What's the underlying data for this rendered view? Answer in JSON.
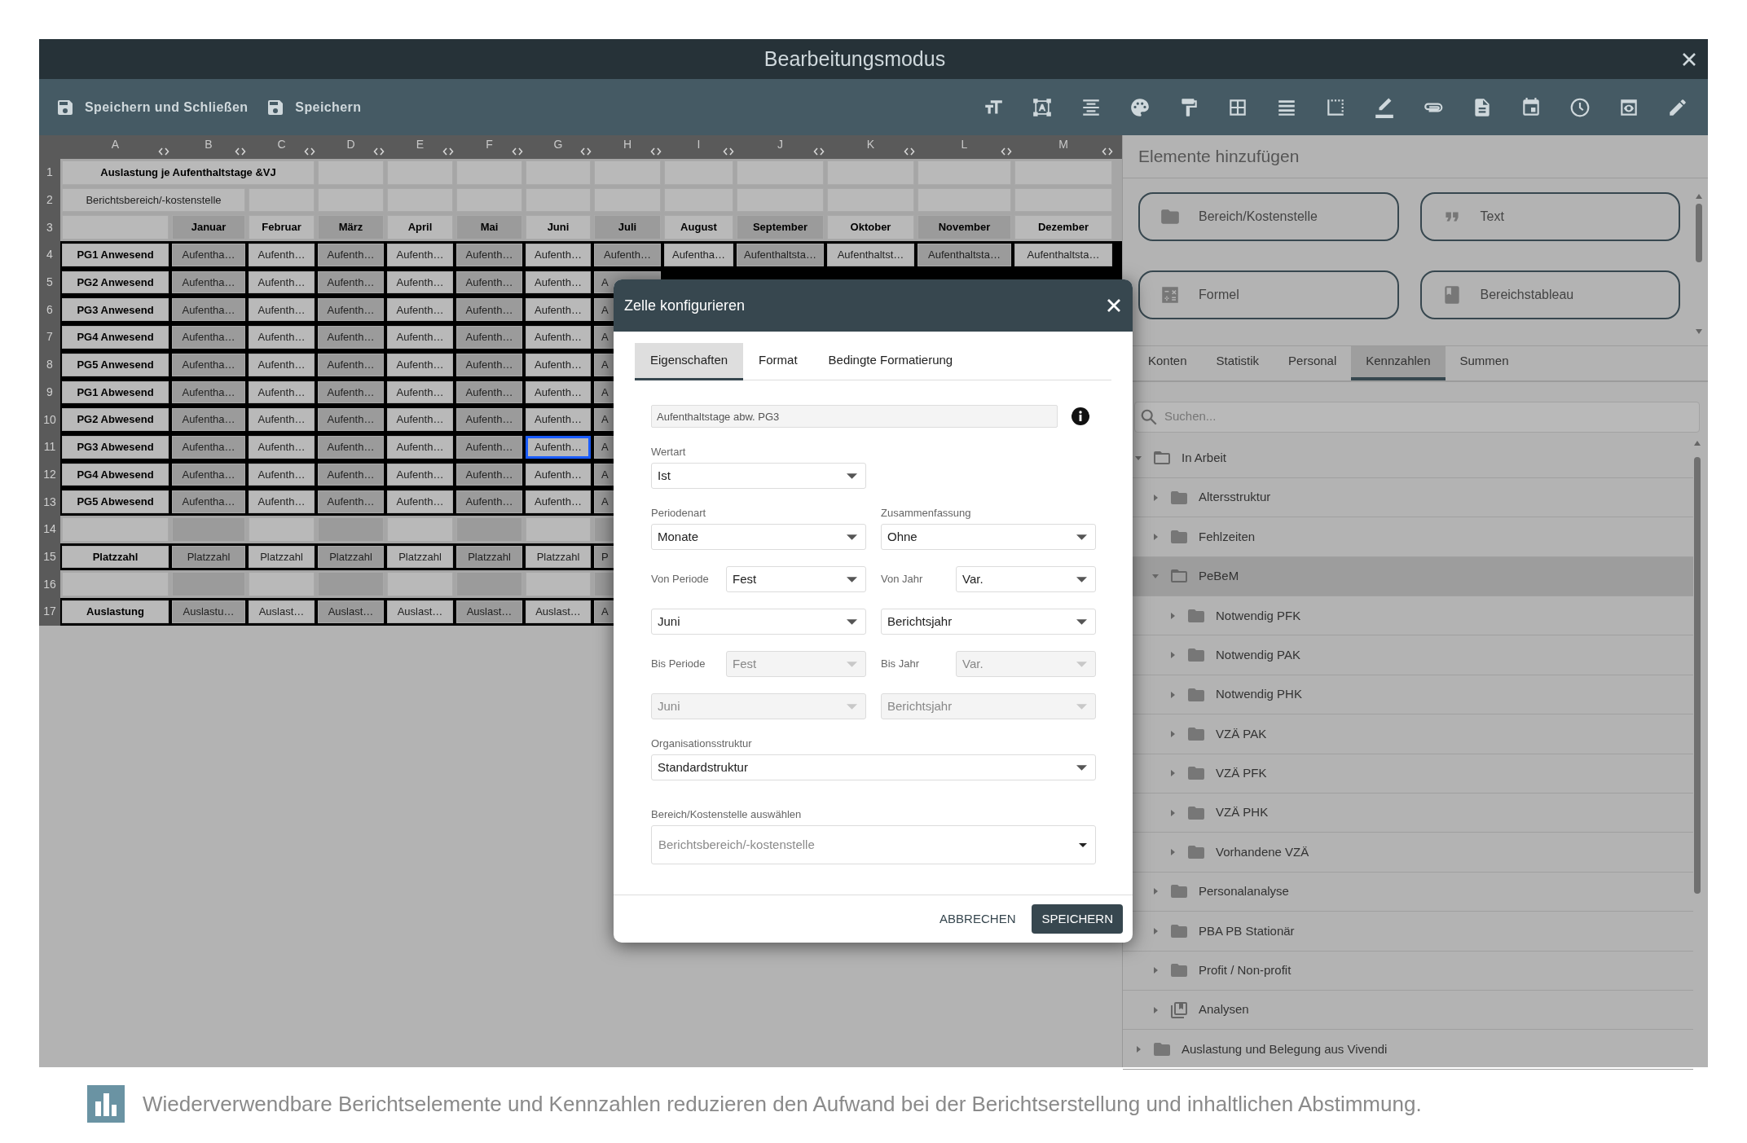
{
  "window": {
    "title": "Bearbeitungsmodus"
  },
  "toolbar": {
    "actions": [
      {
        "label": "Speichern und Schließen"
      },
      {
        "label": "Speichern"
      }
    ]
  },
  "sheet": {
    "columns": [
      "A",
      "B",
      "C",
      "D",
      "E",
      "F",
      "G",
      "H",
      "I",
      "J",
      "K",
      "L",
      "M"
    ],
    "rows": [
      {
        "number": "1",
        "kind": "title",
        "cells": [
          {
            "text": "Auslastung je Aufenthaltstage &VJ",
            "selected": false
          },
          {
            "selected": false
          },
          {
            "selected": false
          },
          {
            "selected": false
          },
          {
            "selected": false
          },
          {
            "selected": false
          },
          {
            "selected": false
          },
          {
            "selected": false
          },
          {
            "selected": false
          },
          {
            "selected": false
          },
          {
            "selected": false
          }
        ]
      },
      {
        "number": "2",
        "kind": "subtitle",
        "cells": [
          {
            "text": "Berichtsbereich/-kostenstelle",
            "selected": false
          },
          {
            "selected": false
          },
          {
            "selected": false
          },
          {
            "selected": false
          },
          {
            "selected": false
          },
          {
            "selected": false
          },
          {
            "selected": false
          },
          {
            "selected": false
          },
          {
            "selected": false
          },
          {
            "selected": false
          },
          {
            "selected": false
          },
          {
            "selected": false
          }
        ]
      },
      {
        "number": "3",
        "kind": "header",
        "cells": [
          {
            "selected": false
          },
          {
            "text": "Januar",
            "selected": false
          },
          {
            "text": "Februar",
            "selected": false
          },
          {
            "text": "März",
            "selected": false
          },
          {
            "text": "April",
            "selected": false
          },
          {
            "text": "Mai",
            "selected": false
          },
          {
            "text": "Juni",
            "selected": false
          },
          {
            "text": "Juli",
            "selected": false
          },
          {
            "text": "August",
            "selected": false
          },
          {
            "text": "September",
            "selected": false
          },
          {
            "text": "Oktober",
            "selected": false
          },
          {
            "text": "November",
            "selected": false
          },
          {
            "text": "Dezember",
            "selected": false
          }
        ]
      },
      {
        "number": "4",
        "kind": "data",
        "cells": [
          {
            "text": "PG1 Anwesend",
            "selected": false
          },
          {
            "text": "Aufentha…",
            "selected": false
          },
          {
            "text": "Aufenth…",
            "selected": false
          },
          {
            "text": "Aufenth…",
            "selected": false
          },
          {
            "text": "Aufenth…",
            "selected": false
          },
          {
            "text": "Aufenth…",
            "selected": false
          },
          {
            "text": "Aufenth…",
            "selected": false
          },
          {
            "text": "Aufenth…",
            "selected": false
          },
          {
            "text": "Aufentha…",
            "selected": false
          },
          {
            "text": "Aufenthaltsta…",
            "selected": false
          },
          {
            "text": "Aufenthaltst…",
            "selected": false
          },
          {
            "text": "Aufenthaltsta…",
            "selected": false
          },
          {
            "text": "Aufenthaltsta…",
            "selected": false
          }
        ]
      },
      {
        "number": "5",
        "kind": "data",
        "cells": [
          {
            "text": "PG2 Anwesend",
            "selected": false
          },
          {
            "text": "Aufentha…",
            "selected": false
          },
          {
            "text": "Aufenth…",
            "selected": false
          },
          {
            "text": "Aufenth…",
            "selected": false
          },
          {
            "text": "Aufenth…",
            "selected": false
          },
          {
            "text": "Aufenth…",
            "selected": false
          },
          {
            "text": "Aufenth…",
            "selected": false
          },
          {
            "text": "A",
            "selected": false
          }
        ]
      },
      {
        "number": "6",
        "kind": "data",
        "cells": [
          {
            "text": "PG3 Anwesend",
            "selected": false
          },
          {
            "text": "Aufentha…",
            "selected": false
          },
          {
            "text": "Aufenth…",
            "selected": false
          },
          {
            "text": "Aufenth…",
            "selected": false
          },
          {
            "text": "Aufenth…",
            "selected": false
          },
          {
            "text": "Aufenth…",
            "selected": false
          },
          {
            "text": "Aufenth…",
            "selected": false
          },
          {
            "text": "A",
            "selected": false
          }
        ]
      },
      {
        "number": "7",
        "kind": "data",
        "cells": [
          {
            "text": "PG4 Anwesend",
            "selected": false
          },
          {
            "text": "Aufentha…",
            "selected": false
          },
          {
            "text": "Aufenth…",
            "selected": false
          },
          {
            "text": "Aufenth…",
            "selected": false
          },
          {
            "text": "Aufenth…",
            "selected": false
          },
          {
            "text": "Aufenth…",
            "selected": false
          },
          {
            "text": "Aufenth…",
            "selected": false
          },
          {
            "text": "A",
            "selected": false
          }
        ]
      },
      {
        "number": "8",
        "kind": "data",
        "cells": [
          {
            "text": "PG5 Anwesend",
            "selected": false
          },
          {
            "text": "Aufentha…",
            "selected": false
          },
          {
            "text": "Aufenth…",
            "selected": false
          },
          {
            "text": "Aufenth…",
            "selected": false
          },
          {
            "text": "Aufenth…",
            "selected": false
          },
          {
            "text": "Aufenth…",
            "selected": false
          },
          {
            "text": "Aufenth…",
            "selected": false
          },
          {
            "text": "A",
            "selected": false
          }
        ]
      },
      {
        "number": "9",
        "kind": "data",
        "cells": [
          {
            "text": "PG1 Abwesend",
            "selected": false
          },
          {
            "text": "Aufentha…",
            "selected": false
          },
          {
            "text": "Aufenth…",
            "selected": false
          },
          {
            "text": "Aufenth…",
            "selected": false
          },
          {
            "text": "Aufenth…",
            "selected": false
          },
          {
            "text": "Aufenth…",
            "selected": false
          },
          {
            "text": "Aufenth…",
            "selected": false
          },
          {
            "text": "A",
            "selected": false
          }
        ]
      },
      {
        "number": "10",
        "kind": "data",
        "cells": [
          {
            "text": "PG2 Abwesend",
            "selected": false
          },
          {
            "text": "Aufentha…",
            "selected": false
          },
          {
            "text": "Aufenth…",
            "selected": false
          },
          {
            "text": "Aufenth…",
            "selected": false
          },
          {
            "text": "Aufenth…",
            "selected": false
          },
          {
            "text": "Aufenth…",
            "selected": false
          },
          {
            "text": "Aufenth…",
            "selected": false
          },
          {
            "text": "A",
            "selected": false
          }
        ]
      },
      {
        "number": "11",
        "kind": "data",
        "cells": [
          {
            "text": "PG3 Abwesend",
            "selected": false
          },
          {
            "text": "Aufentha…",
            "selected": false
          },
          {
            "text": "Aufenth…",
            "selected": false
          },
          {
            "text": "Aufenth…",
            "selected": false
          },
          {
            "text": "Aufenth…",
            "selected": false
          },
          {
            "text": "Aufenth…",
            "selected": false
          },
          {
            "text": "Aufenth…",
            "selected": true
          },
          {
            "text": "A",
            "selected": false
          }
        ]
      },
      {
        "number": "12",
        "kind": "data",
        "cells": [
          {
            "text": "PG4 Abwesend",
            "selected": false
          },
          {
            "text": "Aufentha…",
            "selected": false
          },
          {
            "text": "Aufenth…",
            "selected": false
          },
          {
            "text": "Aufenth…",
            "selected": false
          },
          {
            "text": "Aufenth…",
            "selected": false
          },
          {
            "text": "Aufenth…",
            "selected": false
          },
          {
            "text": "Aufenth…",
            "selected": false
          },
          {
            "text": "A",
            "selected": false
          }
        ]
      },
      {
        "number": "13",
        "kind": "data",
        "cells": [
          {
            "text": "PG5 Abwesend",
            "selected": false
          },
          {
            "text": "Aufentha…",
            "selected": false
          },
          {
            "text": "Aufenth…",
            "selected": false
          },
          {
            "text": "Aufenth…",
            "selected": false
          },
          {
            "text": "Aufenth…",
            "selected": false
          },
          {
            "text": "Aufenth…",
            "selected": false
          },
          {
            "text": "Aufenth…",
            "selected": false
          },
          {
            "text": "A",
            "selected": false
          }
        ]
      },
      {
        "number": "14",
        "kind": "spacer",
        "cells": [
          {
            "selected": false
          },
          {
            "selected": false
          },
          {
            "selected": false
          },
          {
            "selected": false
          },
          {
            "selected": false
          },
          {
            "selected": false
          },
          {
            "selected": false
          },
          {
            "selected": false
          }
        ]
      },
      {
        "number": "15",
        "kind": "data",
        "cells": [
          {
            "text": "Platzzahl",
            "selected": false
          },
          {
            "text": "Platzzahl",
            "selected": false
          },
          {
            "text": "Platzzahl",
            "selected": false
          },
          {
            "text": "Platzzahl",
            "selected": false
          },
          {
            "text": "Platzzahl",
            "selected": false
          },
          {
            "text": "Platzzahl",
            "selected": false
          },
          {
            "text": "Platzzahl",
            "selected": false
          },
          {
            "text": "P",
            "selected": false
          }
        ]
      },
      {
        "number": "16",
        "kind": "spacer",
        "cells": [
          {
            "selected": false
          },
          {
            "selected": false
          },
          {
            "selected": false
          },
          {
            "selected": false
          },
          {
            "selected": false
          },
          {
            "selected": false
          },
          {
            "selected": false
          },
          {
            "selected": false
          }
        ]
      },
      {
        "number": "17",
        "kind": "data",
        "cells": [
          {
            "text": "Auslastung",
            "selected": false
          },
          {
            "text": "Auslastu…",
            "selected": false
          },
          {
            "text": "Auslast…",
            "selected": false
          },
          {
            "text": "Auslast…",
            "selected": false
          },
          {
            "text": "Auslast…",
            "selected": false
          },
          {
            "text": "Auslast…",
            "selected": false
          },
          {
            "text": "Auslast…",
            "selected": false
          },
          {
            "text": "A",
            "selected": false
          }
        ]
      }
    ]
  },
  "dialog": {
    "title": "Zelle konfigurieren",
    "tabs": [
      {
        "label": "Eigenschaften",
        "selected": true
      },
      {
        "label": "Format",
        "selected": false
      },
      {
        "label": "Bedingte Formatierung",
        "selected": false
      }
    ],
    "name_field": {
      "value": "Aufenthaltstage abw. PG3",
      "disabled": true
    },
    "rows": [
      {
        "fields": [
          {
            "kind": "stacked",
            "label": "Wertart",
            "value": "Ist",
            "disabled": false
          }
        ]
      },
      {
        "fields": [
          {
            "kind": "stacked",
            "label": "Periodenart",
            "value": "Monate",
            "disabled": false
          },
          {
            "kind": "stacked",
            "label": "Zusammenfassung",
            "value": "Ohne",
            "disabled": false
          }
        ]
      },
      {
        "fields": [
          {
            "kind": "inline",
            "label": "Von Periode",
            "value": "Fest",
            "disabled": false
          },
          {
            "kind": "inline",
            "label": "Von Jahr",
            "value": "Var.",
            "disabled": false
          }
        ]
      },
      {
        "fields": [
          {
            "kind": "plain",
            "value": "Juni",
            "disabled": false
          },
          {
            "kind": "plain",
            "value": "Berichtsjahr",
            "disabled": false
          }
        ]
      },
      {
        "fields": [
          {
            "kind": "inline",
            "label": "Bis Periode",
            "value": "Fest",
            "disabled": true
          },
          {
            "kind": "inline",
            "label": "Bis Jahr",
            "value": "Var.",
            "disabled": true
          }
        ]
      },
      {
        "fields": [
          {
            "kind": "plain",
            "value": "Juni",
            "disabled": true
          },
          {
            "kind": "plain",
            "value": "Berichtsjahr",
            "disabled": true
          }
        ]
      },
      {
        "fields": [
          {
            "kind": "wide",
            "label": "Organisationsstruktur",
            "value": "Standardstruktur",
            "disabled": false
          }
        ]
      },
      {
        "fields": [
          {
            "kind": "picker",
            "label": "Bereich/Kostenstelle auswählen",
            "placeholder": "Berichtsbereich/-kostenstelle",
            "disabled": false
          }
        ]
      }
    ],
    "buttons": [
      {
        "label": "ABBRECHEN",
        "kind": "text"
      },
      {
        "label": "SPEICHERN",
        "kind": "primary"
      }
    ]
  },
  "panel": {
    "title": "Elemente hinzufügen",
    "elements": [
      {
        "label": "Bereich/Kostenstelle",
        "kind": "folder"
      },
      {
        "label": "Text",
        "kind": "quote"
      },
      {
        "label": "Formel",
        "kind": "formula"
      },
      {
        "label": "Bereichstableau",
        "kind": "board"
      }
    ],
    "tabs": [
      {
        "label": "Konten",
        "selected": false
      },
      {
        "label": "Statistik",
        "selected": false
      },
      {
        "label": "Personal",
        "selected": false
      },
      {
        "label": "Kennzahlen",
        "selected": true
      },
      {
        "label": "Summen",
        "selected": false
      }
    ],
    "search": {
      "placeholder": "Suchen..."
    },
    "tree": [
      {
        "label": "In Arbeit",
        "kind": "folder",
        "expanded": true,
        "selected": false,
        "children": [
          {
            "label": "Altersstruktur",
            "kind": "folder",
            "expanded": false,
            "selected": false
          },
          {
            "label": "Fehlzeiten",
            "kind": "folder",
            "expanded": false,
            "selected": false
          },
          {
            "label": "PeBeM",
            "kind": "folder",
            "expanded": true,
            "selected": true,
            "children": [
              {
                "label": "Notwendig PFK",
                "kind": "folder",
                "expanded": false,
                "selected": false
              },
              {
                "label": "Notwendig PAK",
                "kind": "folder",
                "expanded": false,
                "selected": false
              },
              {
                "label": "Notwendig PHK",
                "kind": "folder",
                "expanded": false,
                "selected": false
              },
              {
                "label": "VZÄ PAK",
                "kind": "folder",
                "expanded": false,
                "selected": false
              },
              {
                "label": "VZÄ PFK",
                "kind": "folder",
                "expanded": false,
                "selected": false
              },
              {
                "label": "VZÄ PHK",
                "kind": "folder",
                "expanded": false,
                "selected": false
              },
              {
                "label": "Vorhandene VZÄ",
                "kind": "folder",
                "expanded": false,
                "selected": false
              }
            ]
          },
          {
            "label": "Personalanalyse",
            "kind": "folder",
            "expanded": false,
            "selected": false
          },
          {
            "label": "PBA PB Stationär",
            "kind": "folder",
            "expanded": false,
            "selected": false
          },
          {
            "label": "Profit / Non-profit",
            "kind": "folder",
            "expanded": false,
            "selected": false
          },
          {
            "label": "Analysen",
            "kind": "library",
            "expanded": false,
            "selected": false
          }
        ]
      },
      {
        "label": "Auslastung und Belegung aus Vivendi",
        "kind": "folder",
        "expanded": false,
        "selected": false
      }
    ]
  },
  "footer": {
    "text": "Wiederverwendbare Berichtselemente und Kennzahlen reduzieren den Aufwand bei der Berichtserstellung und inhaltlichen Abstimmung."
  }
}
